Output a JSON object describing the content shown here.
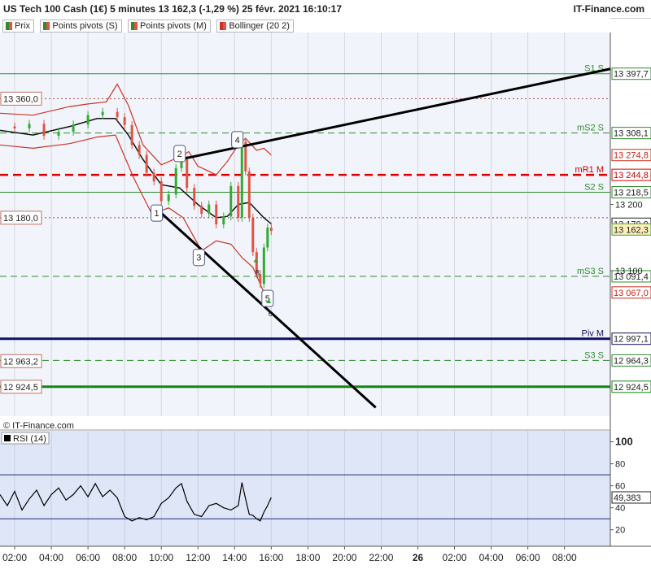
{
  "header": {
    "title": "US Tech 100 Cash (1€) 5 minutes 13 162,3 (-1,29 %) 25 févr. 2021 16:10:17",
    "brand": "IT-Finance.com"
  },
  "legend": [
    {
      "label": "Prix",
      "color": "#2e8b2e"
    },
    {
      "label": "Points pivots (S)",
      "color": "#2e8b2e"
    },
    {
      "label": "Points pivots (M)",
      "color": "#2e8b2e"
    },
    {
      "label": "Bollinger (20 2)",
      "color": "#cc3322"
    }
  ],
  "rsi_panel": {
    "watermark": "© IT-Finance.com",
    "label": "RSI (14)"
  },
  "colors": {
    "candle_up": "#33aa33",
    "candle_down": "#dd5544",
    "bollinger": "#cc3322",
    "moving_average": "#111111",
    "pivot_line": "#2e8b2e",
    "red_dashed": "#dd0000",
    "navy_line": "#101060",
    "green_bold": "#118811",
    "price_bg": "#f2f4fb",
    "rsi_bg": "#dfe6f7"
  },
  "chart_data": [
    {
      "type": "line",
      "subtype": "candlestick",
      "title": "US Tech 100 Cash (1€) 5 minutes",
      "timeframe": "5 minutes",
      "last_price": "13 162,3",
      "change": "-1,29 %",
      "timestamp": "25 févr. 2021 16:10:17",
      "x_ticks": [
        "02:00",
        "04:00",
        "06:00",
        "08:00",
        "10:00",
        "12:00",
        "14:00",
        "16:00",
        "18:00",
        "20:00",
        "22:00",
        "26",
        "02:00",
        "04:00",
        "06:00",
        "08:00"
      ],
      "x_range": [
        1.2,
        34.5
      ],
      "ylim": [
        12880,
        13460
      ],
      "y_ticks": [
        "13 200",
        "13 100"
      ],
      "y_tick_values": [
        13200,
        13100
      ],
      "levels": [
        {
          "label": "S1 S",
          "value": 13397.7,
          "value_label": "13 397,7",
          "style": "solid",
          "color": "#2e8b2e"
        },
        {
          "label": "mS2 S",
          "value": 13308.1,
          "value_label": "13 308,1",
          "style": "dashed",
          "color": "#2e8b2e"
        },
        {
          "label": "mR1 M",
          "value": 13244.8,
          "value_label": "13 244,8",
          "style": "dashed-bold",
          "color": "#dd0000"
        },
        {
          "label": "S2 S",
          "value": 13218.5,
          "value_label": "13 218,5",
          "style": "solid",
          "color": "#2e8b2e"
        },
        {
          "label": "mS3 S",
          "value": 13091.4,
          "value_label": "13 091,4",
          "style": "dashed",
          "color": "#2e8b2e"
        },
        {
          "label": "Piv M",
          "value": 12997.1,
          "value_label": "12 997,1",
          "style": "solid-bold",
          "color": "#101060"
        },
        {
          "label": "S3 S",
          "value": 12964.3,
          "value_label": "12 964,3",
          "style": "dashed",
          "color": "#2e8b2e"
        },
        {
          "label": "",
          "value": 12924.5,
          "value_label": "12 924,5",
          "style": "solid-bold",
          "color": "#118811"
        }
      ],
      "bollinger_values": [
        {
          "label": "13 274,8",
          "value": 13274.8
        },
        {
          "label": "13 067,0",
          "value": 13067.0
        }
      ],
      "ma_value": {
        "label": "13 170,9",
        "value": 13170.9
      },
      "price_value": {
        "label": "13 162,3",
        "value": 13162.3
      },
      "left_boxes": [
        {
          "label": "13 360,0",
          "value": 13360.0,
          "dotted_line": true
        },
        {
          "label": "13 180,0",
          "value": 13180.0,
          "dotted_line": true
        },
        {
          "label": "12 963,2",
          "value": 12963.2
        },
        {
          "label": "12 924,5",
          "value": 12924.5
        }
      ],
      "price": [
        {
          "t": 1.2,
          "c": 13318
        },
        {
          "t": 2.0,
          "c": 13315
        },
        {
          "t": 2.8,
          "c": 13322
        },
        {
          "t": 3.6,
          "c": 13304
        },
        {
          "t": 4.4,
          "c": 13310
        },
        {
          "t": 5.2,
          "c": 13321
        },
        {
          "t": 6.0,
          "c": 13335
        },
        {
          "t": 6.8,
          "c": 13340
        },
        {
          "t": 7.6,
          "c": 13332
        },
        {
          "t": 8.0,
          "c": 13320
        },
        {
          "t": 8.4,
          "c": 13290
        },
        {
          "t": 8.8,
          "c": 13275
        },
        {
          "t": 9.2,
          "c": 13248
        },
        {
          "t": 9.6,
          "c": 13235
        },
        {
          "t": 10.0,
          "c": 13205
        },
        {
          "t": 10.4,
          "c": 13215
        },
        {
          "t": 10.8,
          "c": 13255
        },
        {
          "t": 11.1,
          "c": 13268
        },
        {
          "t": 11.4,
          "c": 13225
        },
        {
          "t": 11.8,
          "c": 13198
        },
        {
          "t": 12.2,
          "c": 13186
        },
        {
          "t": 12.6,
          "c": 13200
        },
        {
          "t": 13.0,
          "c": 13170
        },
        {
          "t": 13.4,
          "c": 13182
        },
        {
          "t": 13.8,
          "c": 13228
        },
        {
          "t": 14.2,
          "c": 13180
        },
        {
          "t": 14.4,
          "c": 13295
        },
        {
          "t": 14.6,
          "c": 13250
        },
        {
          "t": 14.8,
          "c": 13180
        },
        {
          "t": 15.0,
          "c": 13128
        },
        {
          "t": 15.2,
          "c": 13095
        },
        {
          "t": 15.4,
          "c": 13080
        },
        {
          "t": 15.6,
          "c": 13135
        },
        {
          "t": 15.8,
          "c": 13165
        },
        {
          "t": 16.0,
          "c": 13160
        }
      ],
      "moving_average": [
        {
          "t": 1.2,
          "v": 13312
        },
        {
          "t": 3.0,
          "v": 13305
        },
        {
          "t": 5.0,
          "v": 13318
        },
        {
          "t": 6.5,
          "v": 13330
        },
        {
          "t": 7.5,
          "v": 13330
        },
        {
          "t": 8.2,
          "v": 13305
        },
        {
          "t": 9.0,
          "v": 13268
        },
        {
          "t": 10.0,
          "v": 13230
        },
        {
          "t": 11.0,
          "v": 13225
        },
        {
          "t": 12.0,
          "v": 13200
        },
        {
          "t": 13.0,
          "v": 13180
        },
        {
          "t": 13.6,
          "v": 13182
        },
        {
          "t": 14.2,
          "v": 13200
        },
        {
          "t": 14.8,
          "v": 13203
        },
        {
          "t": 15.6,
          "v": 13180
        },
        {
          "t": 16.0,
          "v": 13170.9
        }
      ],
      "bollinger_upper": [
        {
          "t": 1.2,
          "v": 13338
        },
        {
          "t": 3.0,
          "v": 13335
        },
        {
          "t": 5.0,
          "v": 13348
        },
        {
          "t": 6.0,
          "v": 13352
        },
        {
          "t": 7.0,
          "v": 13355
        },
        {
          "t": 7.6,
          "v": 13382
        },
        {
          "t": 8.2,
          "v": 13350
        },
        {
          "t": 9.0,
          "v": 13290
        },
        {
          "t": 10.0,
          "v": 13260
        },
        {
          "t": 11.0,
          "v": 13272
        },
        {
          "t": 11.5,
          "v": 13280
        },
        {
          "t": 12.0,
          "v": 13258
        },
        {
          "t": 13.0,
          "v": 13245
        },
        {
          "t": 13.6,
          "v": 13265
        },
        {
          "t": 14.2,
          "v": 13290
        },
        {
          "t": 14.6,
          "v": 13300
        },
        {
          "t": 15.2,
          "v": 13282
        },
        {
          "t": 15.6,
          "v": 13285
        },
        {
          "t": 16.0,
          "v": 13274.8
        }
      ],
      "bollinger_lower": [
        {
          "t": 1.2,
          "v": 13290
        },
        {
          "t": 3.0,
          "v": 13285
        },
        {
          "t": 5.0,
          "v": 13292
        },
        {
          "t": 6.5,
          "v": 13302
        },
        {
          "t": 7.5,
          "v": 13305
        },
        {
          "t": 8.5,
          "v": 13240
        },
        {
          "t": 9.5,
          "v": 13185
        },
        {
          "t": 10.4,
          "v": 13195
        },
        {
          "t": 11.2,
          "v": 13180
        },
        {
          "t": 12.2,
          "v": 13130
        },
        {
          "t": 13.0,
          "v": 13145
        },
        {
          "t": 13.8,
          "v": 13140
        },
        {
          "t": 14.4,
          "v": 13120
        },
        {
          "t": 15.0,
          "v": 13105
        },
        {
          "t": 15.6,
          "v": 13067
        },
        {
          "t": 16.0,
          "v": 13067.0
        }
      ],
      "trendlines": [
        {
          "name": "upper-trendline",
          "from": {
            "t": 11.0,
            "v": 13268
          },
          "to": {
            "t": 34.5,
            "v": 13405
          }
        },
        {
          "name": "lower-trendline",
          "from": {
            "t": 9.8,
            "v": 13192
          },
          "to": {
            "t": 21.7,
            "v": 12893
          }
        }
      ],
      "wave_labels": [
        {
          "label": "1",
          "t": 9.75,
          "v": 13187
        },
        {
          "label": "2",
          "t": 11.0,
          "v": 13277
        },
        {
          "label": "3",
          "t": 12.05,
          "v": 13120
        },
        {
          "label": "4",
          "t": 14.15,
          "v": 13298
        },
        {
          "label": "5",
          "t": 15.8,
          "v": 13058
        }
      ],
      "signal_labels": [
        {
          "label": "8",
          "t": 15.25,
          "v": 13098
        },
        {
          "label": "6",
          "t": 15.95,
          "v": 13036
        }
      ]
    },
    {
      "type": "line",
      "title": "RSI (14)",
      "last_value": 49.383,
      "last_value_label": "49,383",
      "ylim": [
        5,
        110
      ],
      "y_ticks": [
        "100",
        "80",
        "60",
        "40",
        "20"
      ],
      "y_tick_values": [
        100,
        80,
        60,
        40,
        20
      ],
      "levels": [
        70,
        30
      ],
      "values": [
        {
          "t": 1.2,
          "v": 52
        },
        {
          "t": 1.6,
          "v": 42
        },
        {
          "t": 2.0,
          "v": 55
        },
        {
          "t": 2.4,
          "v": 38
        },
        {
          "t": 2.8,
          "v": 48
        },
        {
          "t": 3.2,
          "v": 56
        },
        {
          "t": 3.6,
          "v": 42
        },
        {
          "t": 4.0,
          "v": 52
        },
        {
          "t": 4.4,
          "v": 58
        },
        {
          "t": 4.8,
          "v": 47
        },
        {
          "t": 5.2,
          "v": 52
        },
        {
          "t": 5.6,
          "v": 60
        },
        {
          "t": 6.0,
          "v": 50
        },
        {
          "t": 6.4,
          "v": 62
        },
        {
          "t": 6.8,
          "v": 50
        },
        {
          "t": 7.2,
          "v": 56
        },
        {
          "t": 7.6,
          "v": 49
        },
        {
          "t": 8.0,
          "v": 32
        },
        {
          "t": 8.4,
          "v": 28
        },
        {
          "t": 8.8,
          "v": 31
        },
        {
          "t": 9.2,
          "v": 29
        },
        {
          "t": 9.6,
          "v": 32
        },
        {
          "t": 10.0,
          "v": 44
        },
        {
          "t": 10.4,
          "v": 49
        },
        {
          "t": 10.8,
          "v": 58
        },
        {
          "t": 11.1,
          "v": 62
        },
        {
          "t": 11.4,
          "v": 46
        },
        {
          "t": 11.8,
          "v": 34
        },
        {
          "t": 12.2,
          "v": 32
        },
        {
          "t": 12.6,
          "v": 42
        },
        {
          "t": 13.0,
          "v": 44
        },
        {
          "t": 13.4,
          "v": 40
        },
        {
          "t": 13.8,
          "v": 38
        },
        {
          "t": 14.2,
          "v": 42
        },
        {
          "t": 14.4,
          "v": 63
        },
        {
          "t": 14.6,
          "v": 48
        },
        {
          "t": 14.8,
          "v": 34
        },
        {
          "t": 15.0,
          "v": 33
        },
        {
          "t": 15.2,
          "v": 30
        },
        {
          "t": 15.4,
          "v": 28
        },
        {
          "t": 15.6,
          "v": 36
        },
        {
          "t": 15.8,
          "v": 42
        },
        {
          "t": 16.0,
          "v": 49.383
        }
      ]
    }
  ]
}
